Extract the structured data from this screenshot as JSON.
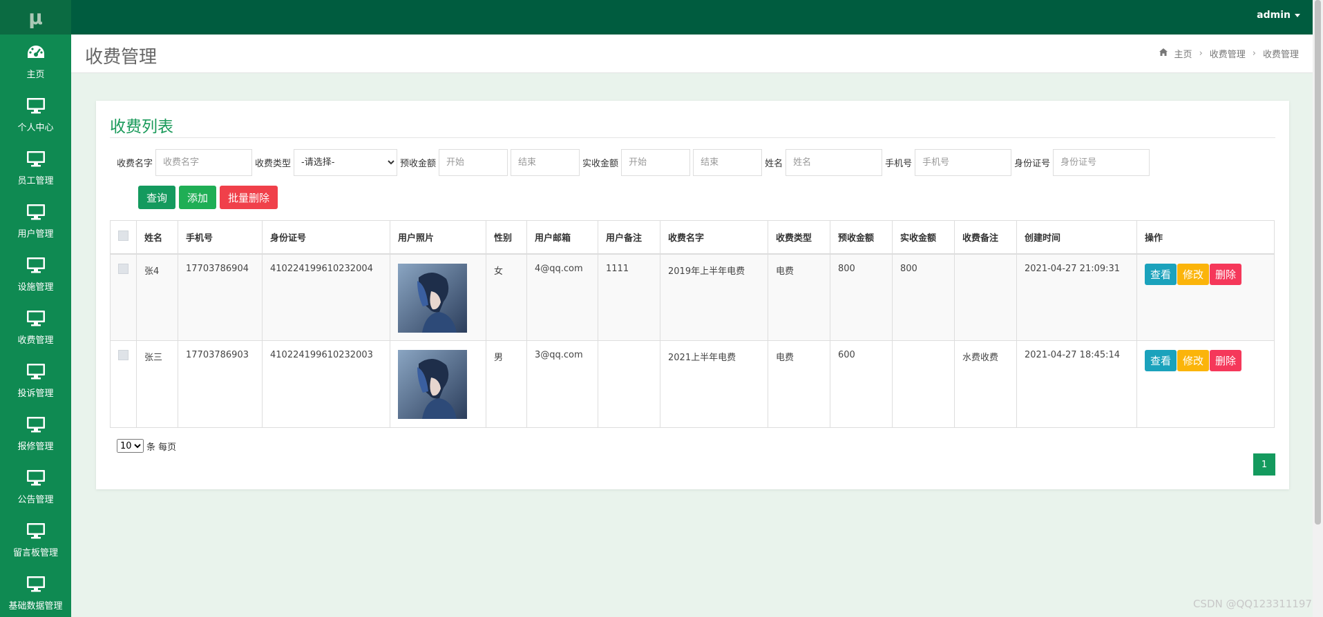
{
  "brand": {
    "logo": "μ"
  },
  "user": {
    "name": "admin"
  },
  "sidebar": {
    "items": [
      {
        "label": "主页",
        "icon": "dashboard-icon"
      },
      {
        "label": "个人中心",
        "icon": "monitor-icon"
      },
      {
        "label": "员工管理",
        "icon": "monitor-icon"
      },
      {
        "label": "用户管理",
        "icon": "monitor-icon"
      },
      {
        "label": "设施管理",
        "icon": "monitor-icon"
      },
      {
        "label": "收费管理",
        "icon": "monitor-icon"
      },
      {
        "label": "投诉管理",
        "icon": "monitor-icon"
      },
      {
        "label": "报修管理",
        "icon": "monitor-icon"
      },
      {
        "label": "公告管理",
        "icon": "monitor-icon"
      },
      {
        "label": "留言板管理",
        "icon": "monitor-icon"
      },
      {
        "label": "基础数据管理",
        "icon": "monitor-icon"
      }
    ]
  },
  "page": {
    "title": "收费管理",
    "breadcrumb": [
      "主页",
      "收费管理",
      "收费管理"
    ]
  },
  "list": {
    "title": "收费列表",
    "filters": {
      "name_label": "收费名字",
      "name_placeholder": "收费名字",
      "type_label": "收费类型",
      "type_selected": "-请选择-",
      "pre_label": "预收金额",
      "pre_start": "开始",
      "pre_end": "结束",
      "act_label": "实收金额",
      "act_start": "开始",
      "act_end": "结束",
      "uname_label": "姓名",
      "uname_placeholder": "姓名",
      "phone_label": "手机号",
      "phone_placeholder": "手机号",
      "idcard_label": "身份证号",
      "idcard_placeholder": "身份证号"
    },
    "buttons": {
      "query": "查询",
      "add": "添加",
      "batch_delete": "批量删除"
    },
    "columns": [
      "姓名",
      "手机号",
      "身份证号",
      "用户照片",
      "性别",
      "用户邮箱",
      "用户备注",
      "收费名字",
      "收费类型",
      "预收金额",
      "实收金额",
      "收费备注",
      "创建时间",
      "操作"
    ],
    "rows": [
      {
        "name": "张4",
        "phone": "17703786904",
        "idcard": "410224199610232004",
        "gender": "女",
        "email": "4@qq.com",
        "user_note": "1111",
        "fee_name": "2019年上半年电费",
        "fee_type": "电费",
        "pre_amount": "800",
        "act_amount": "800",
        "fee_note": "",
        "created": "2021-04-27 21:09:31"
      },
      {
        "name": "张三",
        "phone": "17703786903",
        "idcard": "410224199610232003",
        "gender": "男",
        "email": "3@qq.com",
        "user_note": "",
        "fee_name": "2021上半年电费",
        "fee_type": "电费",
        "pre_amount": "600",
        "act_amount": "",
        "fee_note": "水费收费",
        "created": "2021-04-27 18:45:14"
      }
    ],
    "row_actions": {
      "view": "查看",
      "edit": "修改",
      "delete": "删除"
    },
    "pagination": {
      "page_size": "10",
      "page_size_suffix": "条 每页",
      "current_page": "1"
    }
  },
  "watermark": "CSDN @QQ123311197",
  "colors": {
    "sidebar": "#0f8a52",
    "topbar": "#005c3f",
    "accent": "#1a9a5a"
  }
}
